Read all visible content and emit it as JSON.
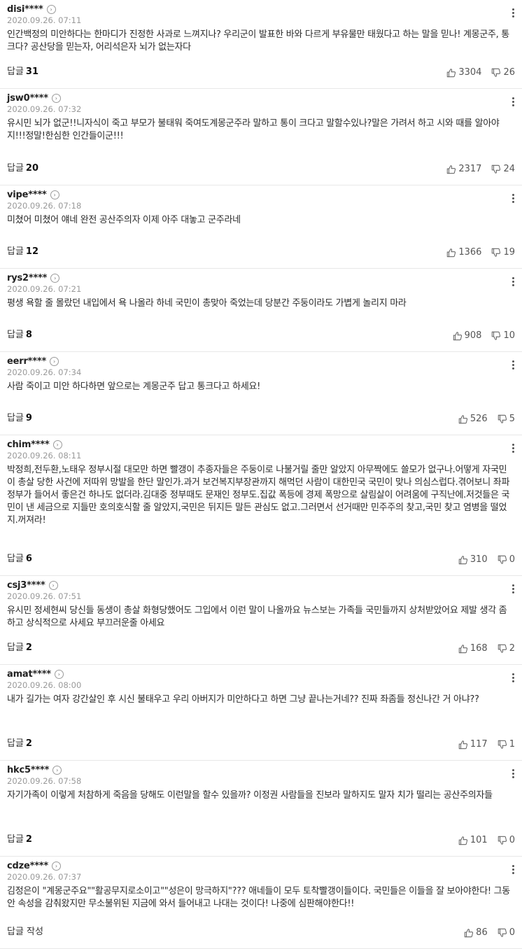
{
  "comments": [
    {
      "nick": "disi****",
      "date": "2020.09.26. 07:11",
      "text": "인간백정의 미안하다는 한마디가 진정한 사과로 느껴지나? 우리군이 발표한 바와 다르게 부유물만 태웠다고 하는 말을 믿나! 계몽군주, 통크다? 공산당을 믿는자, 어리석은자 뇌가 없는자다",
      "reply_label": "답글",
      "reply_count": "31",
      "likes": "3304",
      "dislikes": "26"
    },
    {
      "nick": "jsw0****",
      "date": "2020.09.26. 07:32",
      "text": "유시민 뇌가 없군!!니자식이 죽고 부모가 불태워 죽여도계몽군주라 말하고 통이 크다고 말할수있나?말은 가려서 하고 시와 때를 알아야지!!!정말!한심한 인간들이군!!!",
      "reply_label": "답글",
      "reply_count": "20",
      "likes": "2317",
      "dislikes": "24"
    },
    {
      "nick": "vipe****",
      "date": "2020.09.26. 07:18",
      "text": "미쳤어 미쳤어 얘네 완전 공산주의자 이제 아주 대놓고 군주라네",
      "reply_label": "답글",
      "reply_count": "12",
      "likes": "1366",
      "dislikes": "19"
    },
    {
      "nick": "rys2****",
      "date": "2020.09.26. 07:21",
      "text": "평생 욕할 줄 몰랐던 내입에서 욕 나올라 하네 국민이 총맞아 죽었는데 당분간 주둥이라도 가볍게 놀리지 마라",
      "reply_label": "답글",
      "reply_count": "8",
      "likes": "908",
      "dislikes": "10"
    },
    {
      "nick": "eerr****",
      "date": "2020.09.26. 07:34",
      "text": "사람 죽이고 미안 하다하면 앞으로는 계몽군주 답고 통크다고 하세요!",
      "reply_label": "답글",
      "reply_count": "9",
      "likes": "526",
      "dislikes": "5"
    },
    {
      "nick": "chim****",
      "date": "2020.09.26. 08:11",
      "text": "박정희,전두환,노태우 정부시절 대모만 하면 빨갱이 추종자들은 주둥이로 나불거릴 줄만 알았지 아무짝에도 쓸모가 없구나.어떻게 자국민이 총살 당한 사건에 저따위 망발을 한단 말인가.과거 보건복지부장관까지 해먹던 사람이 대한민국 국민이 맞나 의심스럽다.겪어보니 좌파 정부가 들어서 좋은건 하나도 없더라.김대중 정부때도 문재인 정부도.집값 폭등에 경제 폭망으로 살림살이 어려움에 구직난에.저것들은 국민이 낸 세금으로 지들만 호의호식할 줄 알았지,국민은 뒤지든 말든 관심도 없고.그러면서 선거때만 민주주의 찾고,국민 찾고 염병을 떨었지.꺼져라!",
      "reply_label": "답글",
      "reply_count": "6",
      "likes": "310",
      "dislikes": "0"
    },
    {
      "nick": "csj3****",
      "date": "2020.09.26. 07:51",
      "text": "유시민 정세현씨 당신들 동생이 총살 화형당했어도 그입에서 이런 말이 나올까요 뉴스보는 가족들 국민들까지 상처받았어요 제발 생각 좀 하고 상식적으로 사세요 부끄러운줄 아세요",
      "reply_label": "답글",
      "reply_count": "2",
      "likes": "168",
      "dislikes": "2"
    },
    {
      "nick": "amat****",
      "date": "2020.09.26. 08:00",
      "text": "내가 길가는 여자 강간살인 후 시신 불태우고 우리 아버지가 미안하다고 하면 그냥 끝나는거네?? 진짜 좌좀들 정신나간 거 아냐??",
      "reply_label": "답글",
      "reply_count": "2",
      "likes": "117",
      "dislikes": "1"
    },
    {
      "nick": "hkc5****",
      "date": "2020.09.26. 07:58",
      "text": "자기가족이 이렇게 처참하게 죽음을 당해도 이런말을 할수 있을까? 이정권 사람들을 진보라 말하지도 말자 치가 떨리는 공산주의자들",
      "reply_label": "답글",
      "reply_count": "2",
      "likes": "101",
      "dislikes": "0"
    },
    {
      "nick": "cdze****",
      "date": "2020.09.26. 07:37",
      "text": "김정은이 \"계몽군주요\"\"활공무지로소이고\"\"성은이 망극하지\"??? 애네들이 모두 토착빨갱이들이다. 국민들은 이들을 잘 보아야한다! 그동안 속성을 감춰왔지만 무소불위된 지금에 와서 들어내고 나대는 것이다! 나중에 심판해야한다!!",
      "reply_label": "답글 작성",
      "reply_count": "",
      "likes": "86",
      "dislikes": "0"
    }
  ]
}
